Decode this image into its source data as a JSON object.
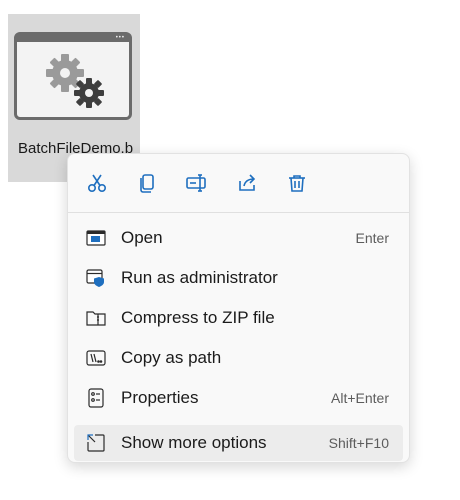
{
  "file": {
    "name": "BatchFileDemo.b",
    "icon": "batch-file-gears-icon"
  },
  "context_menu": {
    "toolbar": [
      {
        "action": "Cut",
        "icon": "cut-icon"
      },
      {
        "action": "Copy",
        "icon": "copy-icon"
      },
      {
        "action": "Rename",
        "icon": "rename-icon"
      },
      {
        "action": "Share",
        "icon": "share-icon"
      },
      {
        "action": "Delete",
        "icon": "delete-icon"
      }
    ],
    "items": [
      {
        "label": "Open",
        "accelerator": "Enter",
        "icon": "open-window-icon"
      },
      {
        "label": "Run as administrator",
        "accelerator": "",
        "icon": "admin-shield-icon"
      },
      {
        "label": "Compress to ZIP file",
        "accelerator": "",
        "icon": "zip-folder-icon"
      },
      {
        "label": "Copy as path",
        "accelerator": "",
        "icon": "copy-path-icon"
      },
      {
        "label": "Properties",
        "accelerator": "Alt+Enter",
        "icon": "properties-icon"
      },
      {
        "label": "Show more options",
        "accelerator": "Shift+F10",
        "icon": "show-more-options-icon"
      }
    ]
  },
  "colors": {
    "accent": "#1f6fbf",
    "menu_background": "#f9f9f9",
    "selection_tile": "#d9d9d9"
  }
}
